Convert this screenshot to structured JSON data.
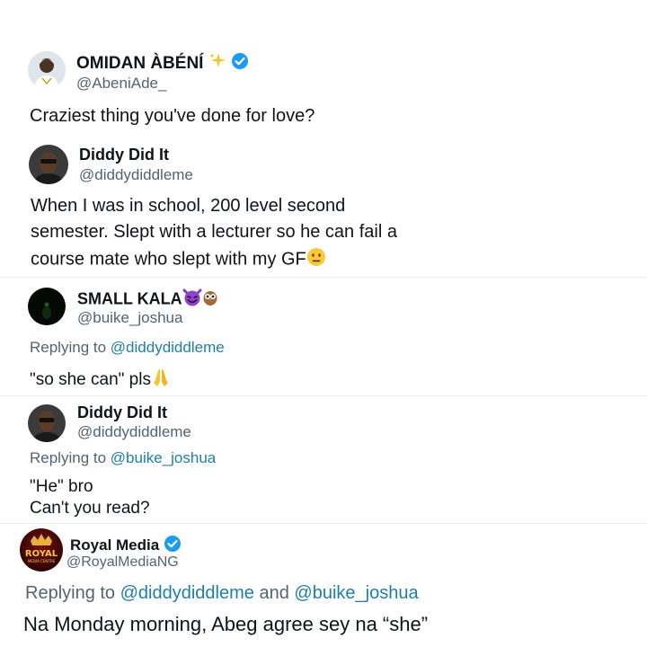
{
  "posts": [
    {
      "author": "OMIDAN ÀBÉNÍ",
      "name_emoji": "sparkles-emoji",
      "verified": true,
      "handle": "@AbeniAde_",
      "text": [
        "Craziest thing you've done for love?"
      ]
    },
    {
      "author": "Diddy Did It",
      "handle": "@diddydiddleme",
      "text": [
        "When I was in school, 200 level second",
        "semester. Slept with a lecturer so he can fail a",
        "course mate who slept with my GF"
      ],
      "trailing_emoji": "neutral-face-emoji"
    },
    {
      "author": "SMALL KALA",
      "name_emojis": [
        "smiling-devil-emoji",
        "owl-emoji"
      ],
      "handle": "@buike_joshua",
      "replying_label": "Replying to",
      "replying_to": [
        "@diddydiddleme"
      ],
      "text": [
        "\"so she can\" pls"
      ],
      "trailing_emoji": "folded-hands-emoji"
    },
    {
      "author": "Diddy Did It",
      "handle": "@diddydiddleme",
      "replying_label": "Replying to",
      "replying_to": [
        "@buike_joshua"
      ],
      "text": [
        "\"He\" bro",
        "Can't you read?"
      ]
    },
    {
      "author": "Royal Media",
      "verified": true,
      "handle": "@RoyalMediaNG",
      "avatar_text": [
        "ROYAL",
        "MEDIA CENTRE"
      ],
      "replying_label": "Replying to",
      "replying_to": [
        "@diddydiddleme",
        "@buike_joshua"
      ],
      "replying_joiner": "and",
      "text": [
        "Na Monday morning, Abeg agree sey na “she”"
      ]
    }
  ],
  "colors": {
    "verified": "#1d9bf0",
    "mention": "#1d7fa8",
    "secondary_text": "#536471"
  }
}
